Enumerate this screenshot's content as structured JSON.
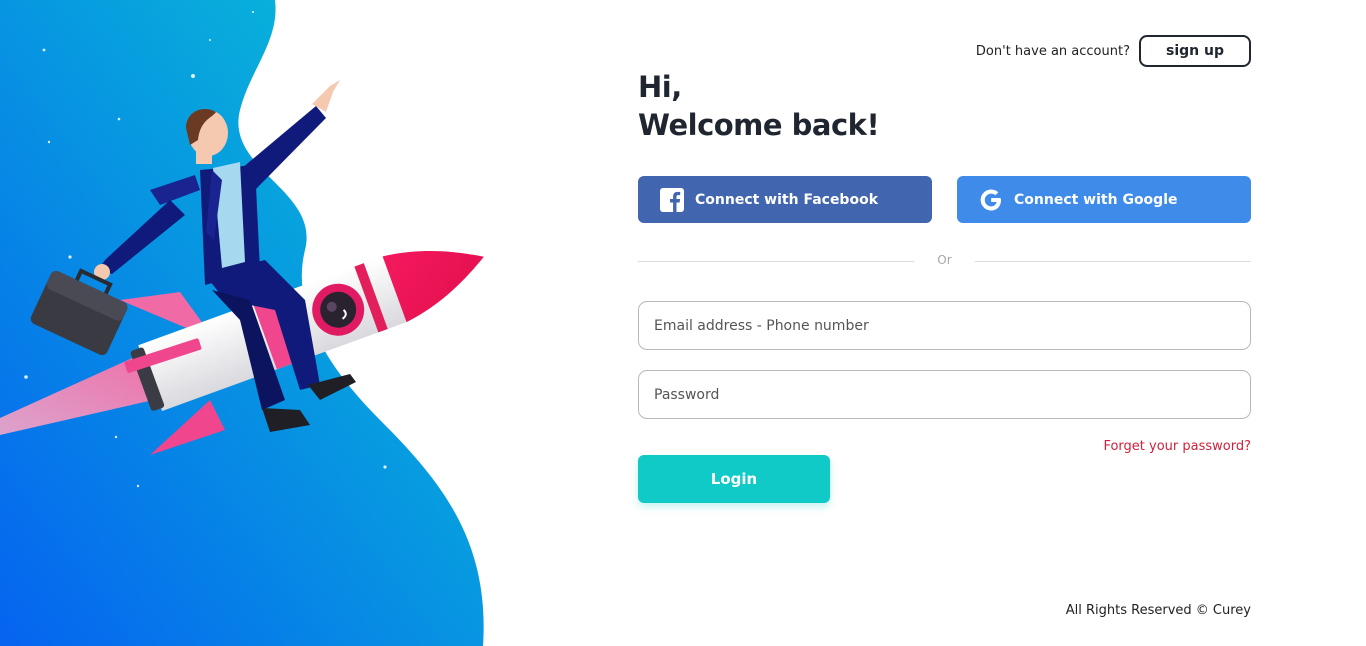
{
  "header": {
    "signup_prompt": "Don't have an account?",
    "signup_label": "sign up"
  },
  "greeting": {
    "line1": "Hi,",
    "line2": "Welcome back!"
  },
  "social": {
    "facebook_label": "Connect with Facebook",
    "facebook_icon": "facebook-icon",
    "google_label": "Connect with Google",
    "google_icon": "google-icon"
  },
  "divider": {
    "label": "Or"
  },
  "form": {
    "email_placeholder": "Email address - Phone number",
    "email_value": "",
    "password_placeholder": "Password",
    "password_value": "",
    "forgot_label": "Forget your password?",
    "login_label": "Login"
  },
  "footer": {
    "copyright": "All Rights Reserved © Curey"
  },
  "colors": {
    "facebook": "#4265af",
    "google": "#3f8bea",
    "login": "#0fcac7",
    "forgot": "#d11f3c",
    "heading": "#1f2630"
  }
}
